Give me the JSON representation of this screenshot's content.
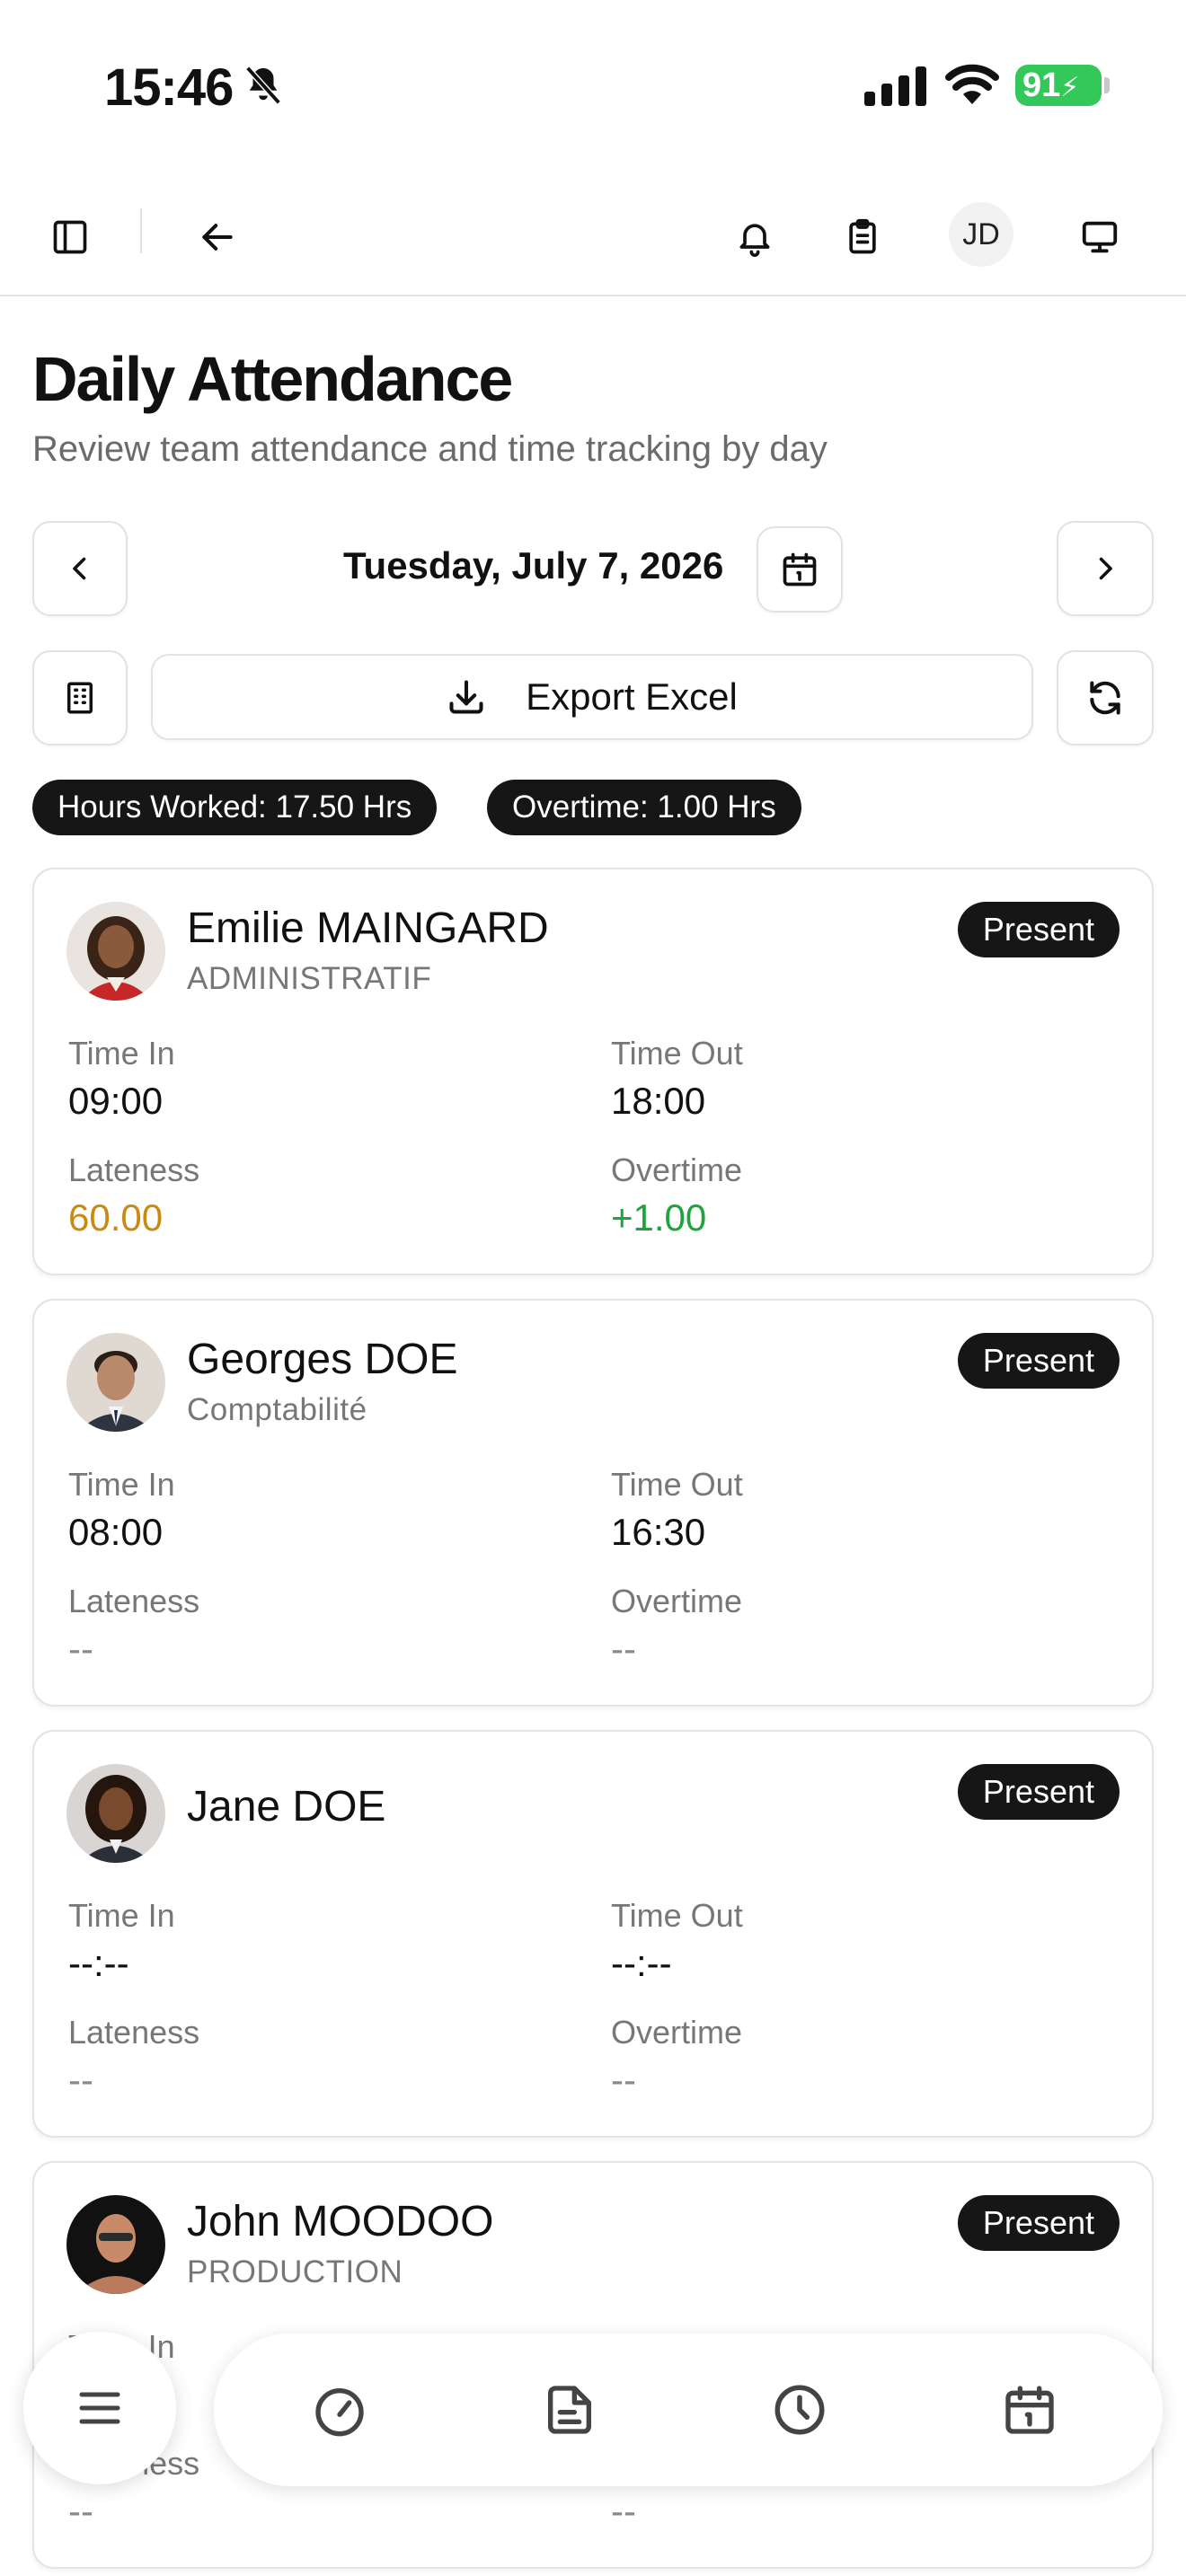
{
  "status_bar": {
    "time": "15:46",
    "battery": "91"
  },
  "header": {
    "user_initials": "JD"
  },
  "page": {
    "title": "Daily Attendance",
    "subtitle": "Review team attendance and time tracking by day",
    "date": "Tuesday, July 7, 2026",
    "export_label": "Export Excel"
  },
  "summary": {
    "hours_worked": "Hours Worked: 17.50 Hrs",
    "overtime": "Overtime: 1.00 Hrs"
  },
  "labels": {
    "time_in": "Time In",
    "time_out": "Time Out",
    "lateness": "Lateness",
    "overtime": "Overtime"
  },
  "employees": [
    {
      "name": "Emilie MAINGARD",
      "department": "ADMINISTRATIF",
      "status": "Present",
      "time_in": "09:00",
      "time_out": "18:00",
      "lateness": "60.00",
      "overtime": "+1.00"
    },
    {
      "name": "Georges DOE",
      "department": "Comptabilité",
      "status": "Present",
      "time_in": "08:00",
      "time_out": "16:30",
      "lateness": "--",
      "overtime": "--"
    },
    {
      "name": "Jane DOE",
      "department": "",
      "status": "Present",
      "time_in": "--:--",
      "time_out": "--:--",
      "lateness": "--",
      "overtime": "--"
    },
    {
      "name": "John MOODOO",
      "department": "PRODUCTION",
      "status": "Present",
      "time_in": "",
      "time_out": "",
      "lateness": "--",
      "overtime": "--"
    }
  ],
  "colors": {
    "accent_dark": "#161616",
    "lateness": "#c98a12",
    "overtime": "#1ea33f",
    "battery": "#34c759"
  },
  "icons": {
    "topbar": [
      "sidebar-toggle-icon",
      "arrow-left-icon",
      "bell-icon",
      "clipboard-icon",
      "monitor-icon"
    ],
    "bottom_nav": [
      "menu-icon",
      "gauge-icon",
      "document-icon",
      "clock-icon",
      "calendar-icon"
    ]
  }
}
